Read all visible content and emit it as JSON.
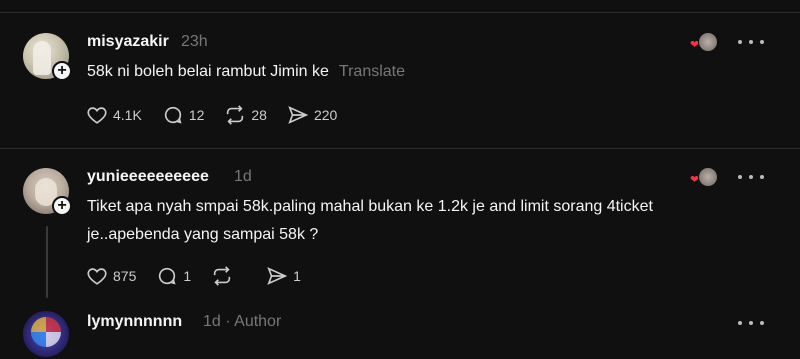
{
  "posts": [
    {
      "username": "misyazakir",
      "time": "23h",
      "text": "58k ni boleh belai rambut Jimin ke",
      "translate": "Translate",
      "likes": "4.1K",
      "comments": "12",
      "reposts": "28",
      "shares": "220"
    },
    {
      "username": "yunieeeeeeeeee",
      "time": "1d",
      "text_line1": "Tiket apa nyah smpai 58k.paling mahal bukan ke 1.2k je and limit sorang 4ticket",
      "text_line2": "je..apebenda yang sampai 58k ?",
      "likes": "875",
      "comments": "1",
      "shares": "1"
    },
    {
      "username": "lymynnnnnn",
      "time": "1d",
      "tag": "Author"
    }
  ],
  "icons": {
    "heart": "heart-icon",
    "comment": "comment-icon",
    "repost": "repost-icon",
    "share": "share-icon",
    "more": "more-icon",
    "follow": "plus-icon"
  },
  "colors": {
    "background": "#101010",
    "text": "#f3f5f7",
    "muted": "#777777",
    "like_red": "#ff3040"
  }
}
